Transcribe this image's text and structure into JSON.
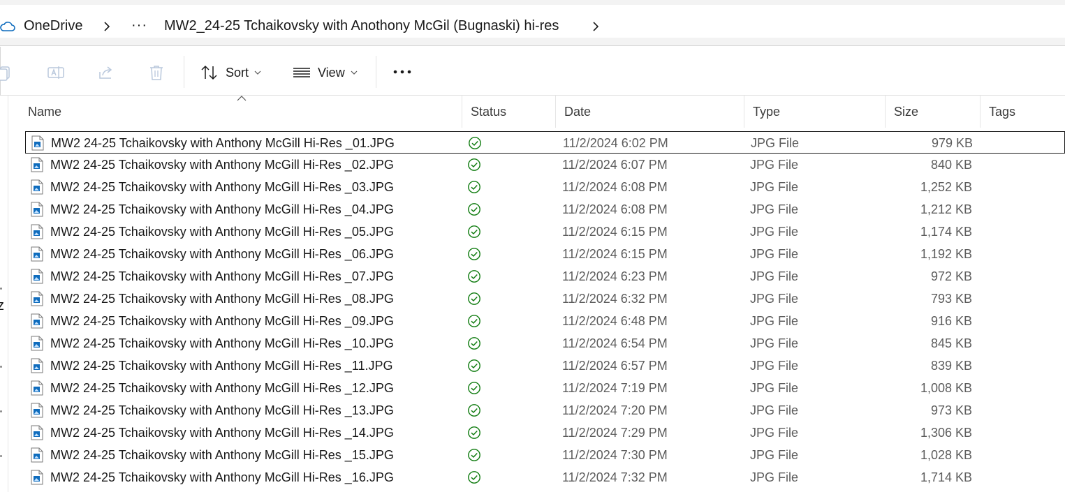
{
  "address_bar": {
    "root": "OneDrive",
    "overflow": "···",
    "folder": "MW2_24-25 Tchaikovsky with Anothony McGil (Bugnaski) hi-res"
  },
  "command_bar": {
    "sort_label": "Sort",
    "view_label": "View",
    "icons": [
      "copy-icon",
      "rename-icon",
      "share-icon",
      "delete-icon",
      "sort-icon",
      "view-icon",
      "more-icon"
    ]
  },
  "left_nav": {
    "partial_label": "z"
  },
  "columns": {
    "name": "Name",
    "status": "Status",
    "date": "Date",
    "type": "Type",
    "size": "Size",
    "tags": "Tags"
  },
  "colors": {
    "accent": "#0f6cbd",
    "status_green": "#107c10",
    "muted_text": "#5c5c5c"
  },
  "files": [
    {
      "name": "MW2 24-25 Tchaikovsky with Anthony McGill Hi-Res _01.JPG",
      "date": "11/2/2024 6:02 PM",
      "type": "JPG File",
      "size": "979 KB",
      "selected": true
    },
    {
      "name": "MW2 24-25 Tchaikovsky with Anthony McGill Hi-Res _02.JPG",
      "date": "11/2/2024 6:07 PM",
      "type": "JPG File",
      "size": "840 KB"
    },
    {
      "name": "MW2 24-25 Tchaikovsky with Anthony McGill Hi-Res _03.JPG",
      "date": "11/2/2024 6:08 PM",
      "type": "JPG File",
      "size": "1,252 KB"
    },
    {
      "name": "MW2 24-25 Tchaikovsky with Anthony McGill Hi-Res _04.JPG",
      "date": "11/2/2024 6:08 PM",
      "type": "JPG File",
      "size": "1,212 KB"
    },
    {
      "name": "MW2 24-25 Tchaikovsky with Anthony McGill Hi-Res _05.JPG",
      "date": "11/2/2024 6:15 PM",
      "type": "JPG File",
      "size": "1,174 KB"
    },
    {
      "name": "MW2 24-25 Tchaikovsky with Anthony McGill Hi-Res _06.JPG",
      "date": "11/2/2024 6:15 PM",
      "type": "JPG File",
      "size": "1,192 KB"
    },
    {
      "name": "MW2 24-25 Tchaikovsky with Anthony McGill Hi-Res _07.JPG",
      "date": "11/2/2024 6:23 PM",
      "type": "JPG File",
      "size": "972 KB"
    },
    {
      "name": "MW2 24-25 Tchaikovsky with Anthony McGill Hi-Res _08.JPG",
      "date": "11/2/2024 6:32 PM",
      "type": "JPG File",
      "size": "793 KB"
    },
    {
      "name": "MW2 24-25 Tchaikovsky with Anthony McGill Hi-Res _09.JPG",
      "date": "11/2/2024 6:48 PM",
      "type": "JPG File",
      "size": "916 KB"
    },
    {
      "name": "MW2 24-25 Tchaikovsky with Anthony McGill Hi-Res _10.JPG",
      "date": "11/2/2024 6:54 PM",
      "type": "JPG File",
      "size": "845 KB"
    },
    {
      "name": "MW2 24-25 Tchaikovsky with Anthony McGill Hi-Res _11.JPG",
      "date": "11/2/2024 6:57 PM",
      "type": "JPG File",
      "size": "839 KB"
    },
    {
      "name": "MW2 24-25 Tchaikovsky with Anthony McGill Hi-Res _12.JPG",
      "date": "11/2/2024 7:19 PM",
      "type": "JPG File",
      "size": "1,008 KB"
    },
    {
      "name": "MW2 24-25 Tchaikovsky with Anthony McGill Hi-Res _13.JPG",
      "date": "11/2/2024 7:20 PM",
      "type": "JPG File",
      "size": "973 KB"
    },
    {
      "name": "MW2 24-25 Tchaikovsky with Anthony McGill Hi-Res _14.JPG",
      "date": "11/2/2024 7:29 PM",
      "type": "JPG File",
      "size": "1,306 KB"
    },
    {
      "name": "MW2 24-25 Tchaikovsky with Anthony McGill Hi-Res _15.JPG",
      "date": "11/2/2024 7:30 PM",
      "type": "JPG File",
      "size": "1,028 KB"
    },
    {
      "name": "MW2 24-25 Tchaikovsky with Anthony McGill Hi-Res _16.JPG",
      "date": "11/2/2024 7:32 PM",
      "type": "JPG File",
      "size": "1,714 KB"
    }
  ]
}
